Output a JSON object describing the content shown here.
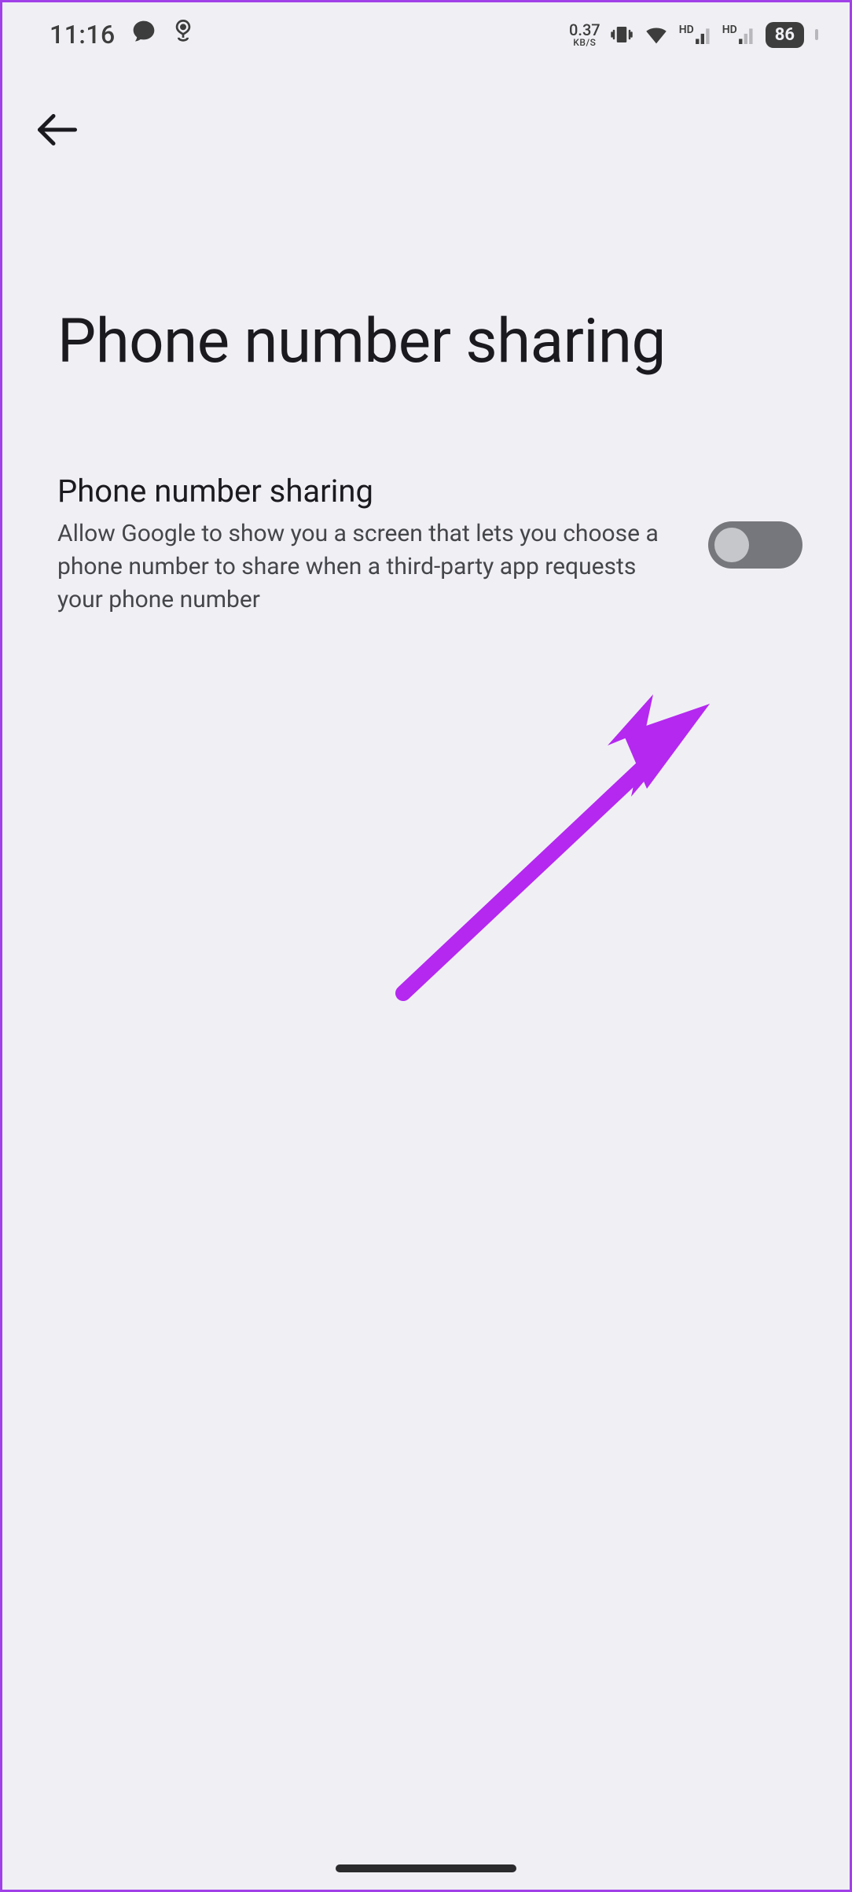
{
  "status_bar": {
    "time": "11:16",
    "data_rate_value": "0.37",
    "data_rate_unit": "KB/S",
    "signal_label": "HD",
    "battery_percent": "86"
  },
  "page": {
    "title": "Phone number sharing"
  },
  "setting": {
    "title": "Phone number sharing",
    "description": "Allow Google to show you a screen that lets you choose a phone number to share when a third-party app requests your phone number",
    "toggle_on": false
  },
  "annotation": {
    "arrow_color": "#b428f0"
  }
}
